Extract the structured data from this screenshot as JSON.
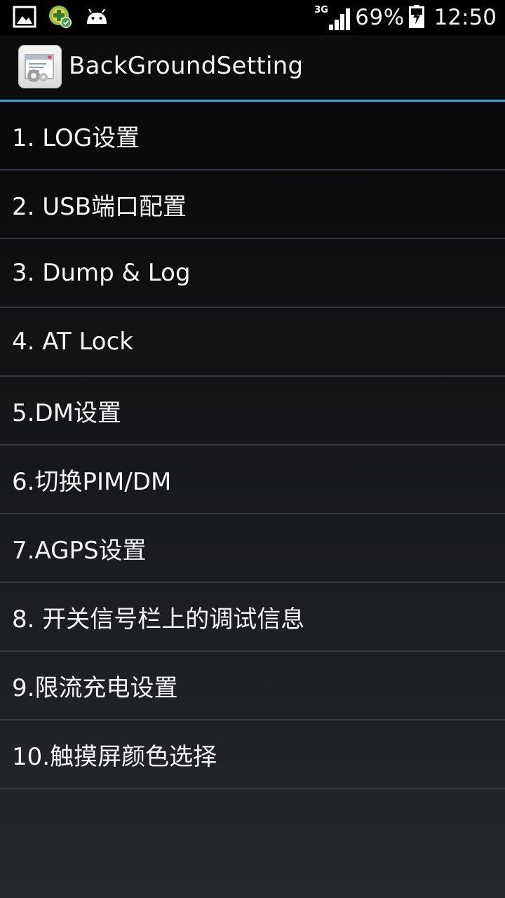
{
  "status_bar": {
    "left_icons": [
      "image-icon",
      "app-update-icon",
      "android-icon"
    ],
    "network_type": "3G",
    "battery_percent": "69%",
    "time": "12:50"
  },
  "action_bar": {
    "app_icon": "settings-app-icon",
    "title": "BackGroundSetting",
    "accent_color": "#33a5d8"
  },
  "menu": {
    "items": [
      {
        "label": "1. LOG设置"
      },
      {
        "label": "2. USB端口配置"
      },
      {
        "label": "3. Dump & Log"
      },
      {
        "label": "4. AT Lock"
      },
      {
        "label": "5.DM设置"
      },
      {
        "label": "6.切换PIM/DM"
      },
      {
        "label": "7.AGPS设置"
      },
      {
        "label": "8. 开关信号栏上的调试信息"
      },
      {
        "label": "9.限流充电设置"
      },
      {
        "label": "10.触摸屏颜色选择"
      }
    ]
  }
}
